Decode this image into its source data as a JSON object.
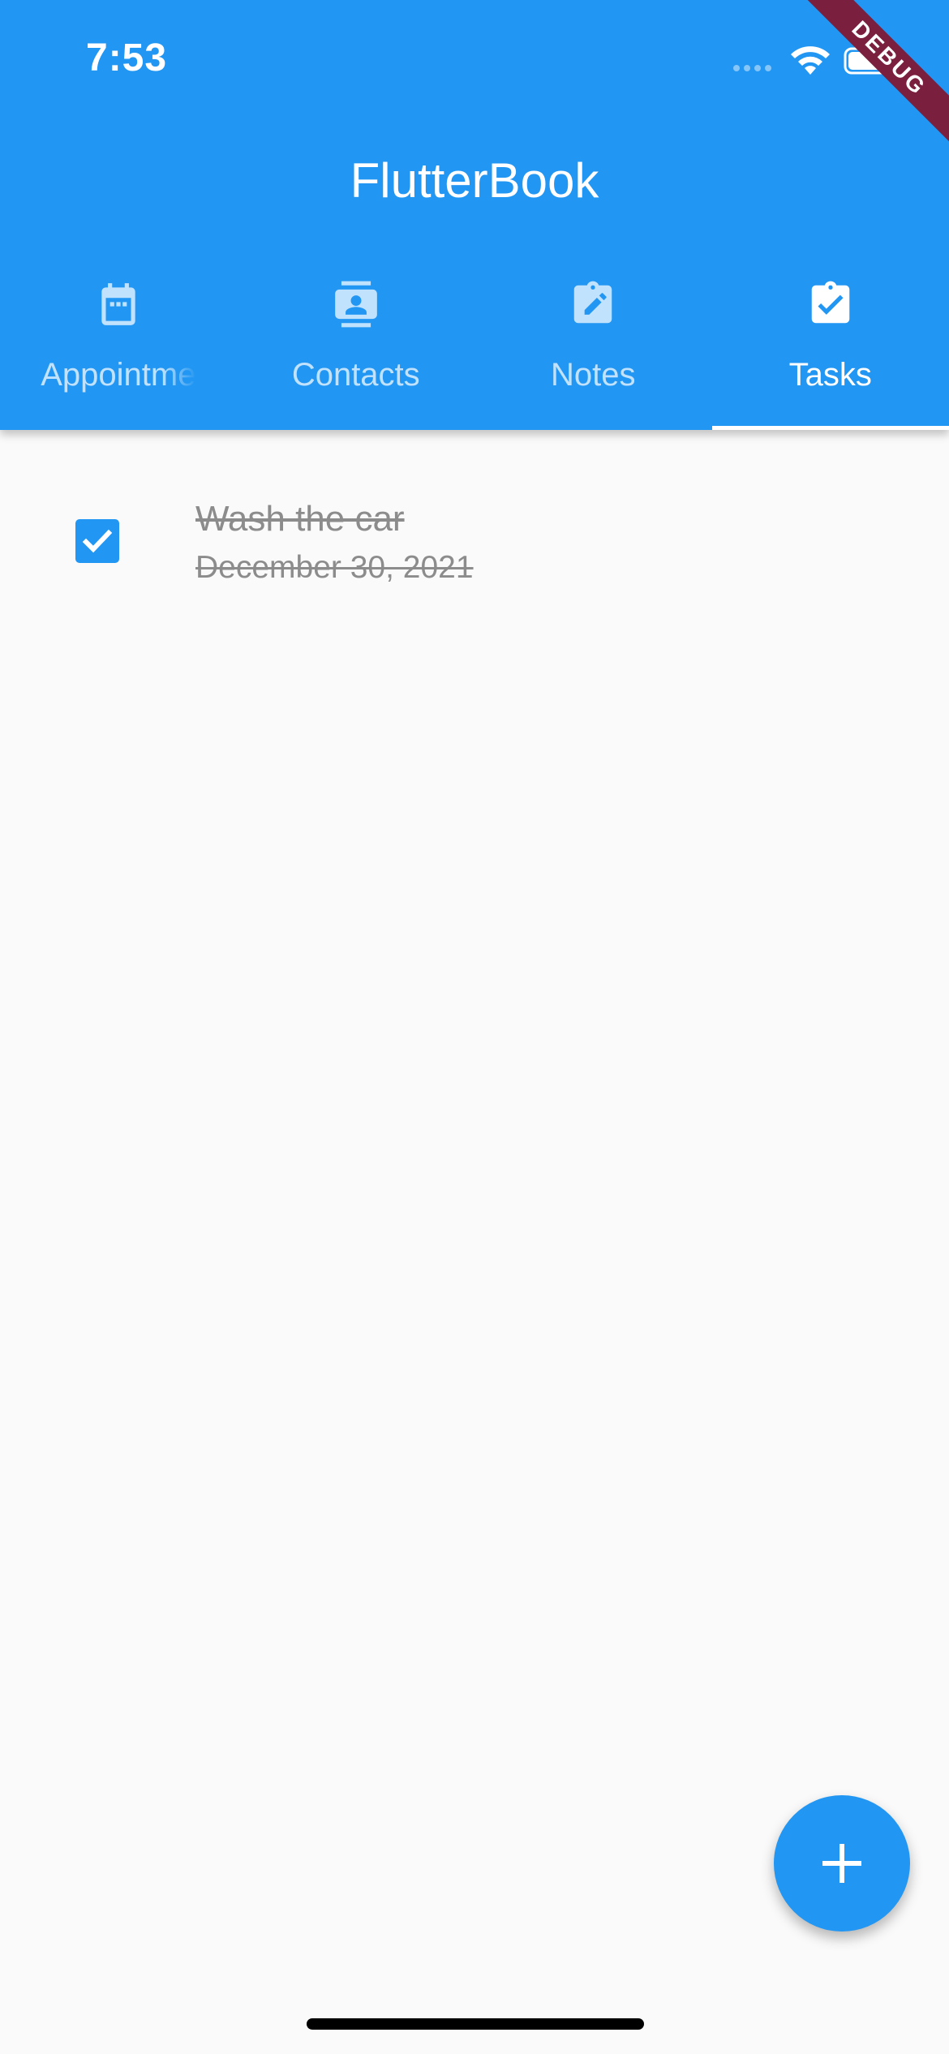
{
  "status_bar": {
    "time": "7:53"
  },
  "debug_banner": "DEBUG",
  "app_bar": {
    "title": "FlutterBook"
  },
  "tabs": [
    {
      "label": "Appointments",
      "icon": "calendar-icon",
      "active": false
    },
    {
      "label": "Contacts",
      "icon": "contact-card-icon",
      "active": false
    },
    {
      "label": "Notes",
      "icon": "note-edit-icon",
      "active": false
    },
    {
      "label": "Tasks",
      "icon": "clipboard-check-icon",
      "active": true
    }
  ],
  "tasks": [
    {
      "title": "Wash the car",
      "due_date": "December 30, 2021",
      "completed": true
    }
  ],
  "fab": {
    "icon": "add-icon"
  },
  "colors": {
    "primary": "#2196f3",
    "background": "#fafafa",
    "completed_text": "#8c8c8c"
  }
}
